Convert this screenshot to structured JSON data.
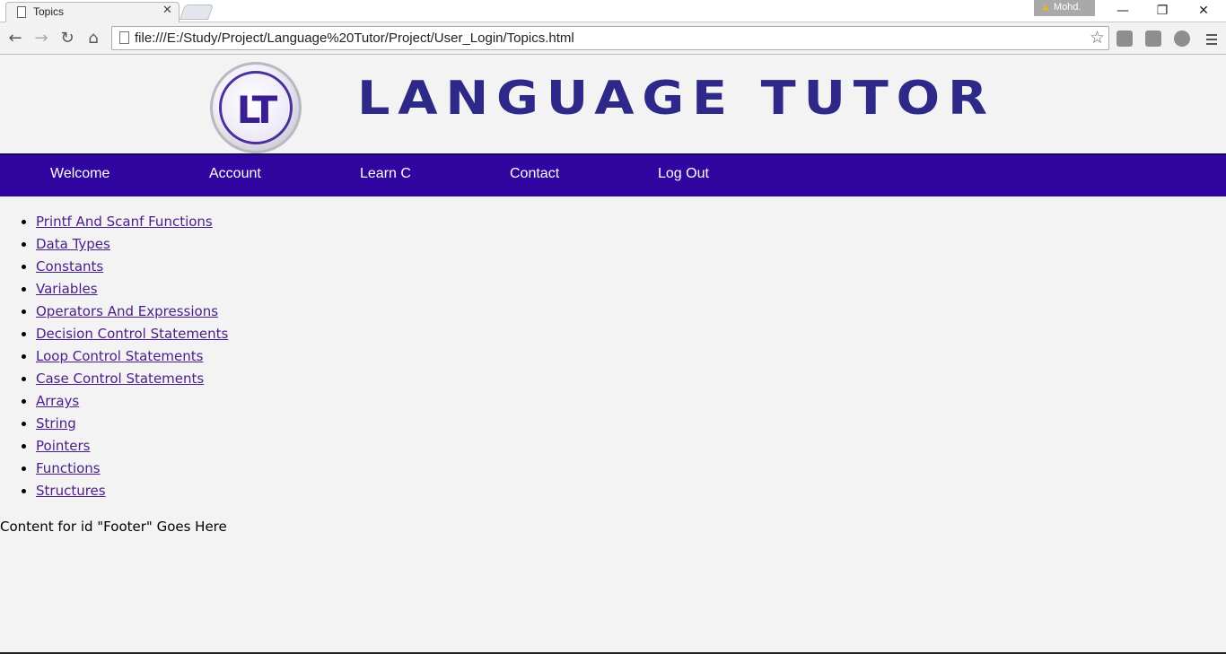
{
  "browser": {
    "tab_title": "Topics",
    "tab_close": "✕",
    "profile_name": "Mohd.",
    "url": "file:///E:/Study/Project/Language%20Tutor/Project/User_Login/Topics.html"
  },
  "header": {
    "logo_text": "LT",
    "brand": "LANGUAGE TUTOR"
  },
  "nav": {
    "items": [
      "Welcome",
      "Account",
      "Learn C",
      "Contact",
      "Log Out"
    ]
  },
  "topics": [
    "Printf And Scanf Functions",
    "Data Types",
    "Constants",
    "Variables",
    "Operators And Expressions",
    "Decision Control Statements",
    "Loop Control Statements",
    "Case Control Statements",
    "Arrays",
    "String",
    "Pointers",
    "Functions",
    "Structures"
  ],
  "footer": {
    "text": "Content for id \"Footer\" Goes Here"
  },
  "colors": {
    "nav_bg": "#3105a0",
    "brand": "#2e2888",
    "link": "#4b1d8a",
    "page_bg": "#f3f3f3"
  }
}
